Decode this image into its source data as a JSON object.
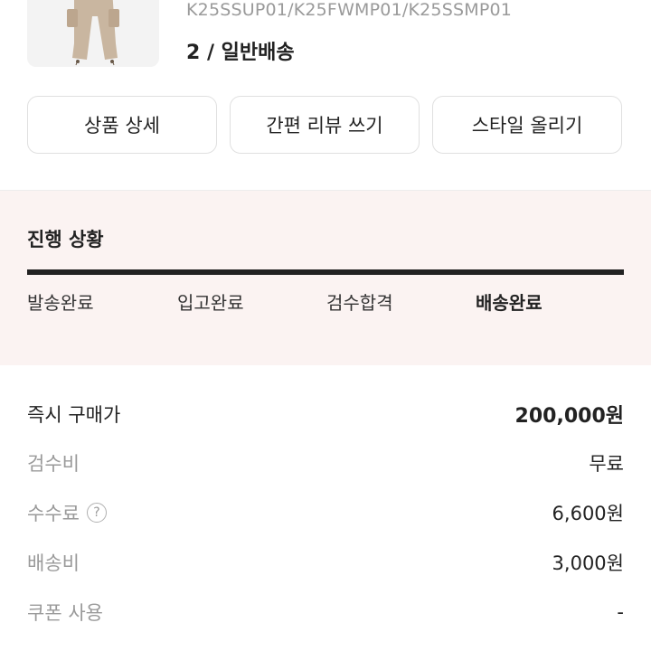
{
  "product": {
    "code": "K25SSUP01/K25FWMP01/K25SSMP01",
    "option": "2 / 일반배송"
  },
  "actions": [
    {
      "label": "상품 상세"
    },
    {
      "label": "간편 리뷰 쓰기"
    },
    {
      "label": "스타일 올리기"
    }
  ],
  "progress": {
    "title": "진행 상황",
    "completed_fraction": 1.0,
    "steps": [
      {
        "label": "발송완료"
      },
      {
        "label": "입고완료"
      },
      {
        "label": "검수합격"
      },
      {
        "label": "배송완료"
      }
    ]
  },
  "prices": [
    {
      "label": "즉시 구매가",
      "value": "200,000원"
    },
    {
      "label": "검수비",
      "value": "무료"
    },
    {
      "label": "수수료",
      "value": "6,600원",
      "help_icon": "question-circle-icon"
    },
    {
      "label": "배송비",
      "value": "3,000원"
    },
    {
      "label": "쿠폰 사용",
      "value": "-"
    }
  ]
}
